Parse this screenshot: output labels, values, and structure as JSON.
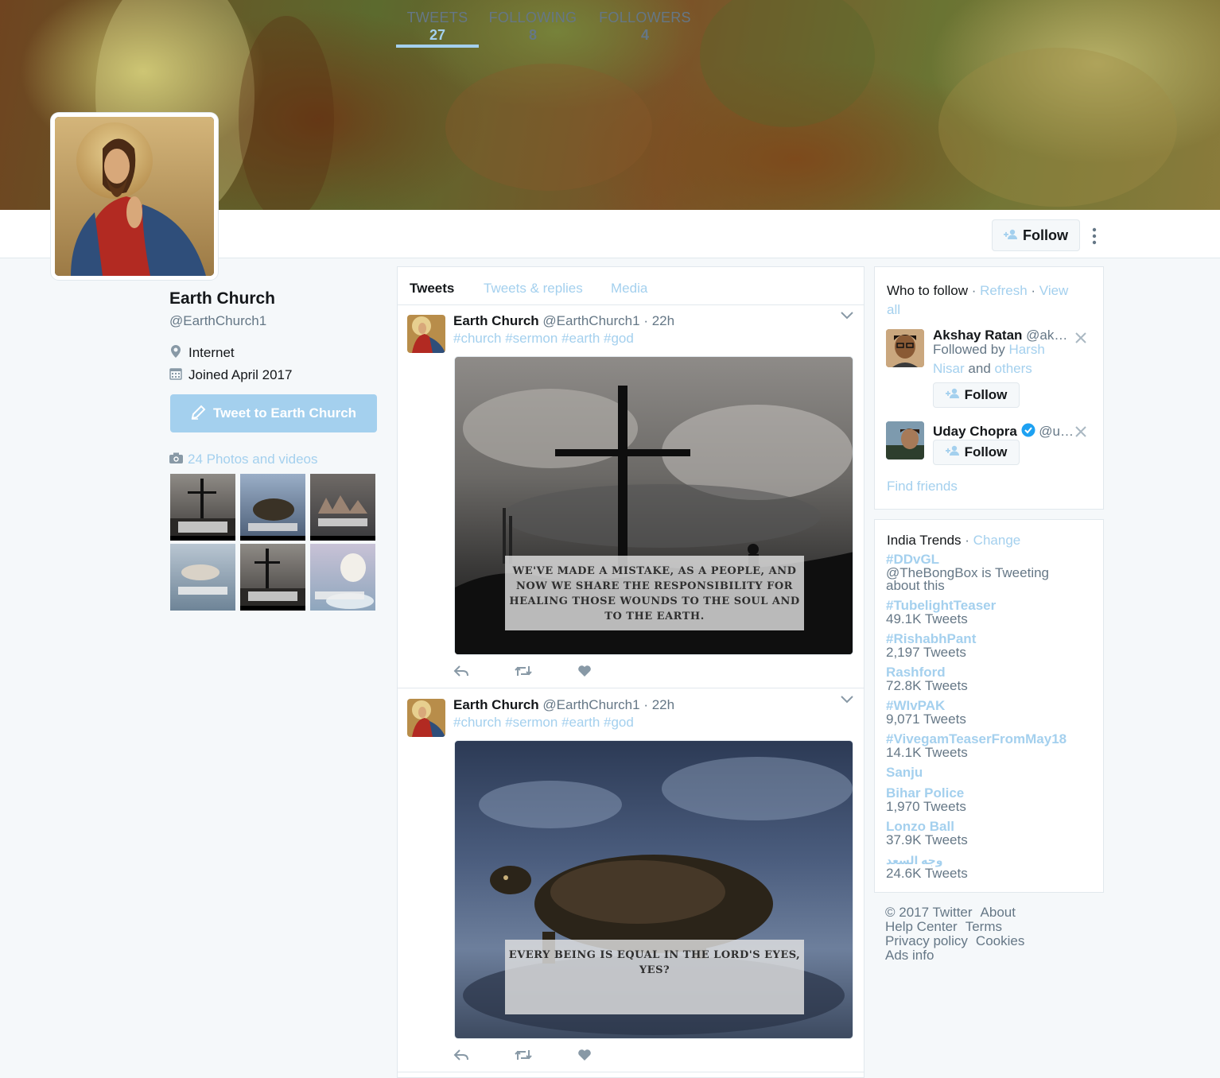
{
  "profile": {
    "name": "Earth Church",
    "handle": "@EarthChurch1",
    "location": "Internet",
    "joined": "Joined April 2017",
    "tweet_to_label": "Tweet to Earth Church",
    "photos_label": "24 Photos and videos"
  },
  "nav": {
    "stats": [
      {
        "label": "TWEETS",
        "value": "27"
      },
      {
        "label": "FOLLOWING",
        "value": "8"
      },
      {
        "label": "FOLLOWERS",
        "value": "4"
      }
    ],
    "follow_label": "Follow",
    "more_glyph": "⋮"
  },
  "timeline": {
    "tabs": [
      "Tweets",
      "Tweets & replies",
      "Media"
    ],
    "tweets": [
      {
        "name": "Earth Church",
        "handle": "@EarthChurch1",
        "time": "· 22h",
        "tags": "#church #sermon #earth #god",
        "quote": "WE'VE MADE A MISTAKE, AS A PEOPLE, AND NOW WE SHARE THE RESPONSIBILITY FOR HEALING THOSE WOUNDS TO THE SOUL AND TO THE EARTH."
      },
      {
        "name": "Earth Church",
        "handle": "@EarthChurch1",
        "time": "· 22h",
        "tags": "#church #sermon #earth #god",
        "quote": "EVERY BEING IS EQUAL IN THE LORD'S EYES, YES?"
      }
    ]
  },
  "who_to_follow": {
    "title": "Who to follow",
    "sep": " · ",
    "refresh": "Refresh",
    "view_all": "View all",
    "users": [
      {
        "name": "Akshay Ratan",
        "handle": "@ak…",
        "followed_by": "Followed by",
        "follower1": "Harsh Nisar",
        "and": "and",
        "others": "others",
        "follow_label": "Follow"
      },
      {
        "name": "Uday Chopra",
        "handle": "@u…",
        "follow_label": "Follow"
      }
    ],
    "find_friends": "Find friends"
  },
  "trends": {
    "title": "India Trends",
    "change": "Change",
    "items": [
      {
        "name": "#DDvGL",
        "count": "@TheBongBox is Tweeting about this"
      },
      {
        "name": "#TubelightTeaser",
        "count": "49.1K Tweets"
      },
      {
        "name": "#RishabhPant",
        "count": "2,197 Tweets"
      },
      {
        "name": "Rashford",
        "count": "72.8K Tweets"
      },
      {
        "name": "#WIvPAK",
        "count": "9,071 Tweets"
      },
      {
        "name": "#VivegamTeaserFromMay18",
        "count": "14.1K Tweets"
      },
      {
        "name": "Sanju",
        "count": ""
      },
      {
        "name": "Bihar Police",
        "count": "1,970 Tweets"
      },
      {
        "name": "Lonzo Ball",
        "count": "37.9K Tweets"
      },
      {
        "name": "وجه السعد",
        "count": "24.6K Tweets"
      }
    ]
  },
  "footer": {
    "links": [
      "© 2017 Twitter",
      "About",
      "Help Center",
      "Terms",
      "Privacy policy",
      "Cookies",
      "Ads info"
    ]
  },
  "colors": {
    "accent": "#a4d0ee",
    "text_muted": "#657786",
    "border": "#e1e8ed",
    "bg": "#f5f8fa"
  },
  "icons": [
    "location-pin-icon",
    "calendar-icon",
    "camera-icon",
    "compose-icon",
    "add-user-icon",
    "reply-icon",
    "retweet-icon",
    "heart-icon",
    "chevron-down-icon",
    "close-icon",
    "verified-badge-icon",
    "more-options-icon"
  ]
}
